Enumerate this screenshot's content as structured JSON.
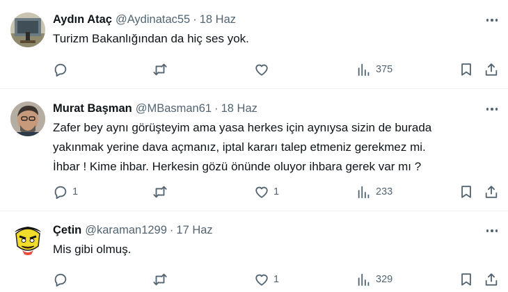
{
  "tweets": [
    {
      "name": "Aydın Ataç",
      "handle": "@Aydinatac55",
      "separator": "·",
      "date": "18 Haz",
      "lines": [
        "Turizm Bakanlığından da hiç ses yok."
      ],
      "replies": "",
      "retweets": "",
      "likes": "",
      "views": "375"
    },
    {
      "name": "Murat Başman",
      "handle": "@MBasman61",
      "separator": "·",
      "date": "18 Haz",
      "lines": [
        "Zafer bey aynı görüşteyim ama yasa herkes için aynıysa sizin de burada",
        "yakınmak yerine dava açmanız, iptal kararı talep etmeniz gerekmez mi.",
        "İhbar ! Kime ihbar. Herkesin gözü önünde oluyor ihbara gerek var mı ?"
      ],
      "replies": "1",
      "retweets": "",
      "likes": "1",
      "views": "233"
    },
    {
      "name": "Çetin",
      "handle": "@karaman1299",
      "separator": "·",
      "date": "17 Haz",
      "lines": [
        "Mis gibi olmuş."
      ],
      "replies": "",
      "retweets": "",
      "likes": "1",
      "views": "329"
    }
  ],
  "icons": {
    "more": "more-horizontal-icon",
    "reply": "reply-icon",
    "retweet": "retweet-icon",
    "like": "heart-icon",
    "views": "views-bar-chart-icon",
    "bookmark": "bookmark-icon",
    "share": "share-icon"
  },
  "colors": {
    "text": "#0f1419",
    "secondary": "#536471",
    "divider": "#eff3f4"
  }
}
